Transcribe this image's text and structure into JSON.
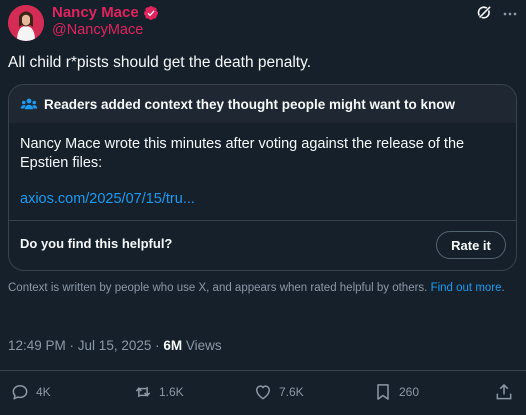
{
  "author": {
    "name": "Nancy Mace",
    "handle": "@NancyMace",
    "avatar_icon": "profile-photo",
    "verified_icon": "verified-badge",
    "name_color": "#e0245e"
  },
  "header_icons": [
    "grok-icon",
    "more-icon"
  ],
  "tweet": {
    "text": "All child r*pists should get the death penalty."
  },
  "community_note": {
    "header": "Readers added context they thought people might want to know",
    "header_icon": "people-icon",
    "body": "Nancy Mace wrote this minutes after voting against the release of the Epstien files:",
    "link": "axios.com/2025/07/15/tru...",
    "helpful_question": "Do you find this helpful?",
    "rate_button": "Rate it"
  },
  "context_footer": {
    "text": "Context is written by people who use X, and appears when rated helpful by others.",
    "link": "Find out more"
  },
  "meta": {
    "time": "12:49 PM",
    "date": "Jul 15, 2025",
    "views_count": "6M",
    "views_label": "Views"
  },
  "actions": {
    "replies": "4K",
    "reposts": "1.6K",
    "likes": "7.6K",
    "bookmarks": "260"
  },
  "colors": {
    "background": "#15202b",
    "accent": "#1d9bf0",
    "muted": "#8b98a5",
    "border": "#38444d"
  }
}
